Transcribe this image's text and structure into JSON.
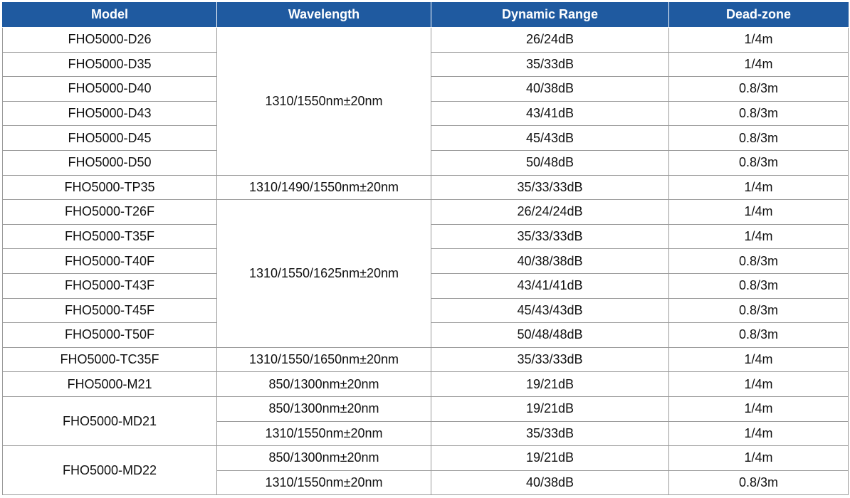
{
  "headers": [
    "Model",
    "Wavelength",
    "Dynamic Range",
    "Dead-zone"
  ],
  "rows": [
    {
      "model": "FHO5000-D26",
      "wavelength": "1310/1550nm±20nm",
      "range": "26/24dB",
      "deadzone": "1/4m"
    },
    {
      "model": "FHO5000-D35",
      "wavelength": "",
      "range": "35/33dB",
      "deadzone": "1/4m"
    },
    {
      "model": "FHO5000-D40",
      "wavelength": "",
      "range": "40/38dB",
      "deadzone": "0.8/3m"
    },
    {
      "model": "FHO5000-D43",
      "wavelength": "",
      "range": "43/41dB",
      "deadzone": "0.8/3m"
    },
    {
      "model": "FHO5000-D45",
      "wavelength": "",
      "range": "45/43dB",
      "deadzone": "0.8/3m"
    },
    {
      "model": "FHO5000-D50",
      "wavelength": "",
      "range": "50/48dB",
      "deadzone": "0.8/3m"
    },
    {
      "model": "FHO5000-TP35",
      "wavelength": "1310/1490/1550nm±20nm",
      "range": "35/33/33dB",
      "deadzone": "1/4m"
    },
    {
      "model": "FHO5000-T26F",
      "wavelength": "1310/1550/1625nm±20nm",
      "range": "26/24/24dB",
      "deadzone": "1/4m"
    },
    {
      "model": "FHO5000-T35F",
      "wavelength": "",
      "range": "35/33/33dB",
      "deadzone": "1/4m"
    },
    {
      "model": "FHO5000-T40F",
      "wavelength": "",
      "range": "40/38/38dB",
      "deadzone": "0.8/3m"
    },
    {
      "model": "FHO5000-T43F",
      "wavelength": "",
      "range": "43/41/41dB",
      "deadzone": "0.8/3m"
    },
    {
      "model": "FHO5000-T45F",
      "wavelength": "",
      "range": "45/43/43dB",
      "deadzone": "0.8/3m"
    },
    {
      "model": "FHO5000-T50F",
      "wavelength": "",
      "range": "50/48/48dB",
      "deadzone": "0.8/3m"
    },
    {
      "model": "FHO5000-TC35F",
      "wavelength": "1310/1550/1650nm±20nm",
      "range": "35/33/33dB",
      "deadzone": "1/4m"
    },
    {
      "model": "FHO5000-M21",
      "wavelength": "850/1300nm±20nm",
      "range": "19/21dB",
      "deadzone": "1/4m"
    },
    {
      "model": "FHO5000-MD21",
      "wavelength": "850/1300nm±20nm",
      "range": "19/21dB",
      "deadzone": "1/4m"
    },
    {
      "model": "",
      "wavelength": "1310/1550nm±20nm",
      "range": "35/33dB",
      "deadzone": "1/4m"
    },
    {
      "model": "FHO5000-MD22",
      "wavelength": "850/1300nm±20nm",
      "range": "19/21dB",
      "deadzone": "1/4m"
    },
    {
      "model": "",
      "wavelength": "1310/1550nm±20nm",
      "range": "40/38dB",
      "deadzone": "0.8/3m"
    }
  ],
  "theme": {
    "header_bg": "#1f5aa0",
    "header_text": "#ffffff",
    "border": "#9a9a9a"
  }
}
